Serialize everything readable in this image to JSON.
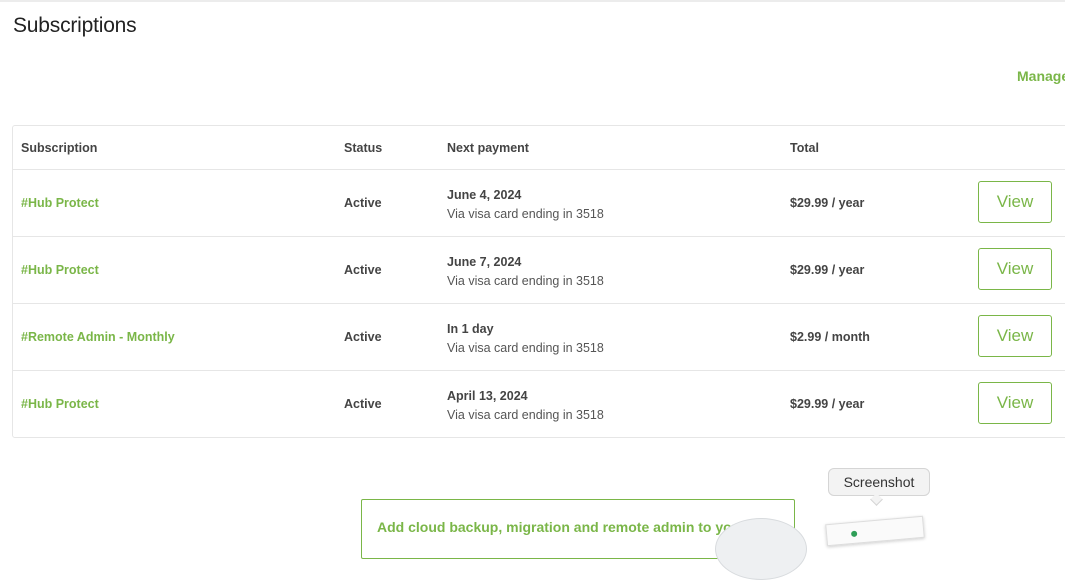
{
  "page": {
    "title": "Subscriptions",
    "manage_link": "Manage"
  },
  "colors": {
    "accent": "#7ab648",
    "border": "#e6e6e6",
    "text": "#444444"
  },
  "table": {
    "headers": {
      "subscription": "Subscription",
      "status": "Status",
      "next_payment": "Next payment",
      "total": "Total"
    },
    "rows": [
      {
        "subscription": "#Hub Protect",
        "status": "Active",
        "next_date": "June 4, 2024",
        "next_via": "Via visa card ending in 3518",
        "total": "$29.99 / year",
        "action": "View"
      },
      {
        "subscription": "#Hub Protect",
        "status": "Active",
        "next_date": "June 7, 2024",
        "next_via": "Via visa card ending in 3518",
        "total": "$29.99 / year",
        "action": "View"
      },
      {
        "subscription": "#Remote Admin - Monthly",
        "status": "Active",
        "next_date": "In 1 day",
        "next_via": "Via visa card ending in 3518",
        "total": "$2.99 / month",
        "action": "View"
      },
      {
        "subscription": "#Hub Protect",
        "status": "Active",
        "next_date": "April 13, 2024",
        "next_via": "Via visa card ending in 3518",
        "total": "$29.99 / year",
        "action": "View"
      }
    ]
  },
  "promo": {
    "text": "Add cloud backup, migration and remote admin to your hub"
  },
  "tooltip": {
    "label": "Screenshot"
  },
  "icons": {
    "thumbnail": "screenshot-thumbnail-icon",
    "device": "hub-device-image"
  }
}
